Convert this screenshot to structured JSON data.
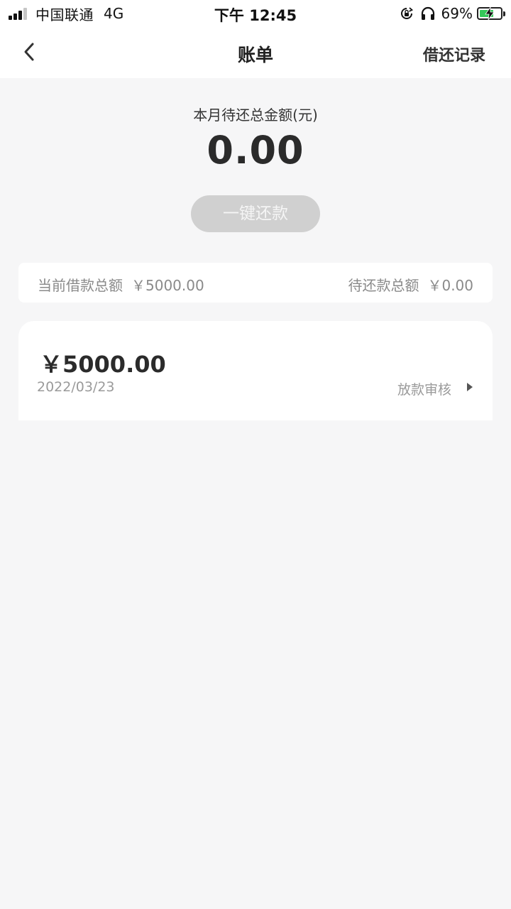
{
  "status_bar": {
    "carrier": "中国联通",
    "network": "4G",
    "time": "下午 12:45",
    "battery_pct": "69%",
    "battery_level": 0.69,
    "battery_color": "#34c759"
  },
  "nav": {
    "back_icon": "chevron-left-icon",
    "title": "账单",
    "right_action": "借还记录"
  },
  "summary": {
    "label": "本月待还总金额(元)",
    "amount": "0.00",
    "repay_button": "一键还款"
  },
  "totals": {
    "borrowed_label": "当前借款总额",
    "borrowed_value": "￥5000.00",
    "pending_label": "待还款总额",
    "pending_value": "￥0.00"
  },
  "bills": [
    {
      "amount": "￥5000.00",
      "date": "2022/03/23",
      "status": "放款审核",
      "icon": "triangle-right-icon"
    }
  ]
}
